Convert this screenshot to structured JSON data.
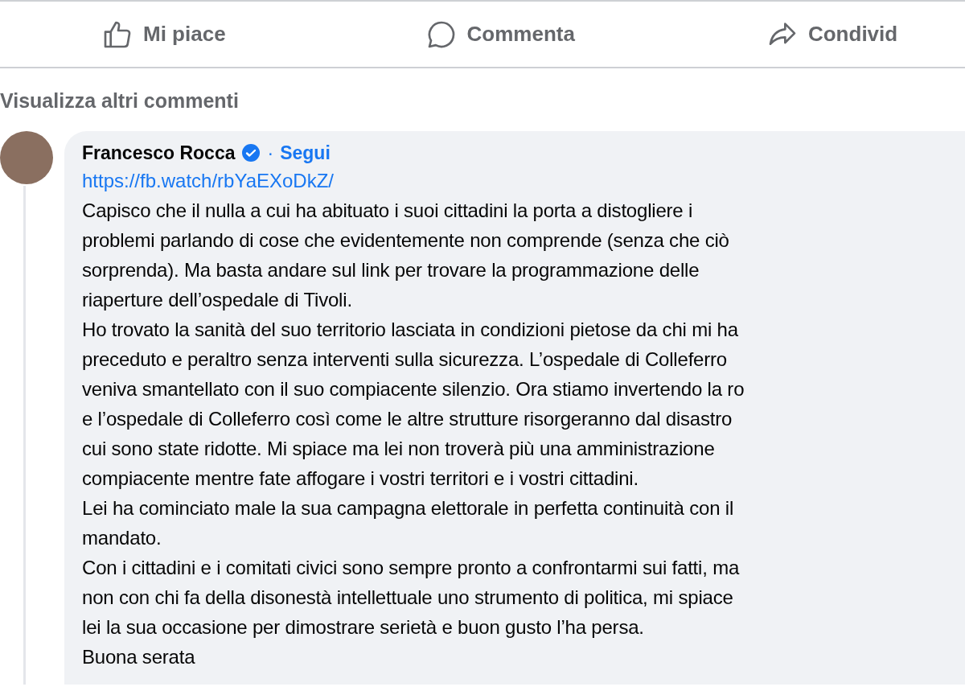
{
  "actions": [
    {
      "kind": "like",
      "label": "Mi piace"
    },
    {
      "kind": "comment",
      "label": "Commenta"
    },
    {
      "kind": "share",
      "label": "Condivid"
    }
  ],
  "more_comments": "Visualizza altri commenti",
  "comment": {
    "author": "Francesco Rocca",
    "verified": true,
    "separator": "·",
    "follow": "Segui",
    "link": "https://fb.watch/rbYaEXoDkZ/",
    "lines": [
      "Capisco che il nulla a cui ha abituato i suoi cittadini la porta a distogliere i",
      "problemi parlando di cose che evidentemente non comprende (senza che ciò",
      "sorprenda). Ma basta andare sul link per trovare la programmazione delle",
      "riaperture dell’ospedale di Tivoli.",
      "Ho trovato la sanità del suo territorio lasciata in condizioni pietose da chi mi ha",
      "preceduto e peraltro senza interventi sulla sicurezza. L’ospedale di Colleferro",
      "veniva smantellato con il suo compiacente silenzio. Ora stiamo invertendo la ro",
      "e l’ospedale di Colleferro così come le altre strutture risorgeranno dal disastro",
      "cui sono state ridotte. Mi spiace ma lei non troverà più una amministrazione",
      "compiacente mentre fate affogare i vostri territori e i vostri cittadini.",
      "Lei ha cominciato male la sua campagna elettorale in perfetta continuità con il",
      "mandato.",
      "Con i cittadini e i comitati civici sono sempre pronto a confrontarmi sui fatti, ma",
      "non con chi fa della disonestà intellettuale uno strumento di politica, mi spiace",
      "lei la sua occasione per dimostrare serietà e buon gusto l’ha persa.",
      "Buona serata"
    ]
  }
}
